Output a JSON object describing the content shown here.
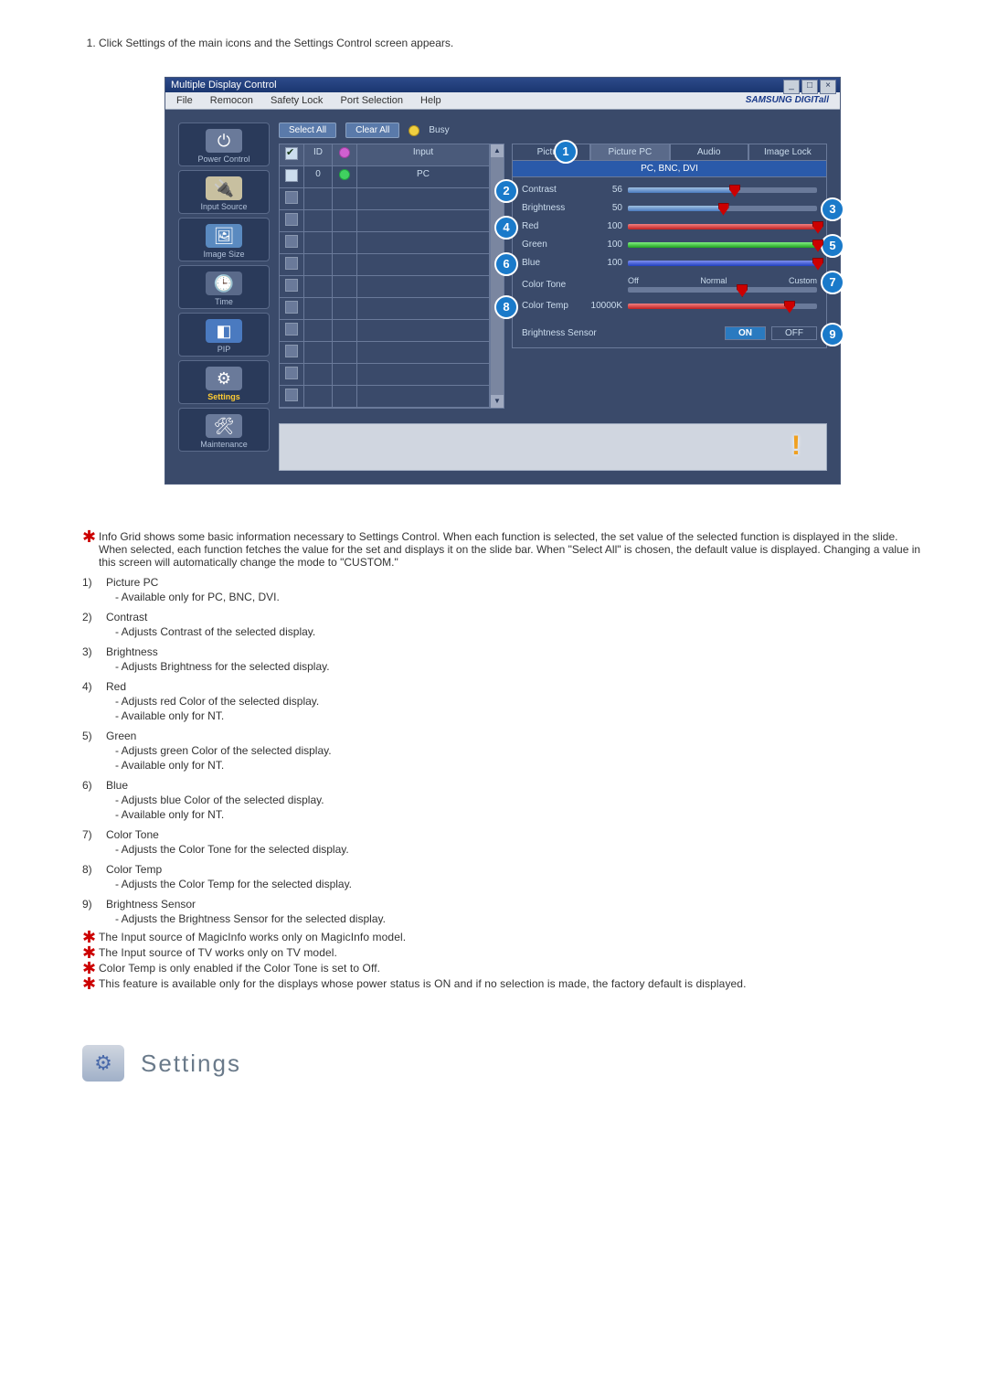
{
  "intro_step": "Click Settings of the main icons and the Settings Control screen appears.",
  "app": {
    "title": "Multiple Display Control",
    "menus": [
      "File",
      "Remocon",
      "Safety Lock",
      "Port Selection",
      "Help"
    ],
    "brand": "SAMSUNG DIGITall",
    "win_buttons": [
      "_",
      "□",
      "×"
    ],
    "toolbar": {
      "select_all": "Select All",
      "clear_all": "Clear All",
      "busy": "Busy"
    },
    "sidebar": [
      {
        "label": "Power Control",
        "icon": "⏻",
        "bg": "#6a7a9a"
      },
      {
        "label": "Input Source",
        "icon": "🔌",
        "bg": "#c8c0a0"
      },
      {
        "label": "Image Size",
        "icon": "🖼",
        "bg": "#5a8ac0"
      },
      {
        "label": "Time",
        "icon": "🕒",
        "bg": "#5a6a8a"
      },
      {
        "label": "PIP",
        "icon": "◧",
        "bg": "#4a7ac0"
      },
      {
        "label": "Settings",
        "icon": "⚙",
        "bg": "#6a7a9a",
        "active": true
      },
      {
        "label": "Maintenance",
        "icon": "🛠",
        "bg": "#6a7a9a"
      }
    ],
    "grid": {
      "headers": {
        "id": "ID",
        "input": "Input"
      },
      "rows": [
        {
          "checked": true,
          "id": "0",
          "power": "green",
          "input": "PC",
          "pwr_icon": "magenta"
        },
        {
          "checked": false
        },
        {
          "checked": false
        },
        {
          "checked": false
        },
        {
          "checked": false
        },
        {
          "checked": false
        },
        {
          "checked": false
        },
        {
          "checked": false
        },
        {
          "checked": false
        },
        {
          "checked": false
        },
        {
          "checked": false
        }
      ],
      "scroll_up": "▲",
      "scroll_down": "▼"
    },
    "tabs": [
      "Picture",
      "Picture PC",
      "Audio",
      "Image Lock"
    ],
    "active_tab": 1,
    "subheader": "PC, BNC, DVI",
    "sliders": [
      {
        "name": "Contrast",
        "value": "56",
        "pct": 56,
        "fill": "",
        "callout": 2,
        "callout_side": "left"
      },
      {
        "name": "Brightness",
        "value": "50",
        "pct": 50,
        "fill": "",
        "callout": 3,
        "callout_side": "right"
      },
      {
        "name": "Red",
        "value": "100",
        "pct": 100,
        "fill": "red",
        "callout": 4,
        "callout_side": "left"
      },
      {
        "name": "Green",
        "value": "100",
        "pct": 100,
        "fill": "green",
        "callout": 5,
        "callout_side": "right"
      },
      {
        "name": "Blue",
        "value": "100",
        "pct": 100,
        "fill": "blue",
        "callout": 6,
        "callout_side": "left"
      }
    ],
    "color_tone": {
      "label": "Color Tone",
      "options": [
        "Off",
        "Normal",
        "Custom"
      ],
      "callout": 7
    },
    "color_temp": {
      "label": "Color Temp",
      "value": "10000K",
      "pct": 85,
      "callout": 8
    },
    "brightness_sensor": {
      "label": "Brightness Sensor",
      "on": "ON",
      "off": "OFF",
      "callout": 9
    },
    "tab1_callout": 1
  },
  "note_intro": "Info Grid shows some basic information necessary to Settings Control. When each function is selected, the set value of the selected function is displayed in the slide. When selected, each function fetches the value for the set and displays it on the slide bar. When \"Select All\" is chosen, the default value is displayed. Changing a value in this screen will automatically change the mode to \"CUSTOM.\"",
  "items": [
    {
      "num": "1)",
      "title": "Picture PC",
      "subs": [
        "- Available only for PC, BNC, DVI."
      ]
    },
    {
      "num": "2)",
      "title": "Contrast",
      "subs": [
        "- Adjusts Contrast of the selected display."
      ]
    },
    {
      "num": "3)",
      "title": "Brightness",
      "subs": [
        "- Adjusts Brightness for the selected display."
      ]
    },
    {
      "num": "4)",
      "title": "Red",
      "subs": [
        "- Adjusts red Color of the selected display.",
        "- Available  only for NT."
      ]
    },
    {
      "num": "5)",
      "title": "Green",
      "subs": [
        "- Adjusts green Color of the selected display.",
        "- Available  only for NT."
      ]
    },
    {
      "num": "6)",
      "title": "Blue",
      "subs": [
        "- Adjusts blue Color of the selected display.",
        "- Available  only for NT."
      ]
    },
    {
      "num": "7)",
      "title": "Color Tone",
      "subs": [
        "- Adjusts the Color Tone for the selected display."
      ]
    },
    {
      "num": "8)",
      "title": "Color Temp",
      "subs": [
        "- Adjusts the Color Temp for the selected display."
      ]
    },
    {
      "num": "9)",
      "title": "Brightness Sensor",
      "subs": [
        "- Adjusts the Brightness Sensor for the selected display."
      ]
    }
  ],
  "footnotes": [
    "The Input source of MagicInfo works only on MagicInfo model.",
    "The Input source of TV works only on TV model.",
    "Color Temp is only enabled if the Color Tone is set to Off.",
    "This feature is available only for the displays whose power status is ON and if no selection is made, the factory default is displayed."
  ],
  "section_heading": "Settings"
}
